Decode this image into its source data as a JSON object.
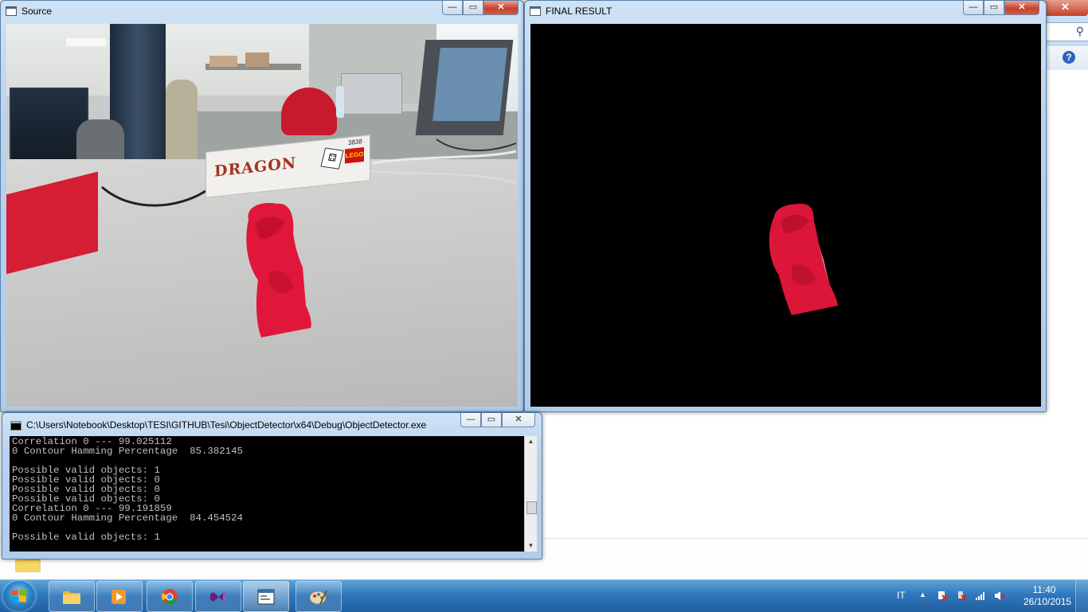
{
  "windows": {
    "source": {
      "title": "Source"
    },
    "final": {
      "title": "FINAL RESULT"
    },
    "console": {
      "title": "C:\\Users\\Notebook\\Desktop\\TESI\\GITHUB\\Tesi\\ObjectDetector\\x64\\Debug\\ObjectDetector.exe",
      "lines": [
        "Correlation 0 --- 99.025112",
        "0 Contour Hamming Percentage  85.382145",
        "",
        "Possible valid objects: 1",
        "Possible valid objects: 0",
        "Possible valid objects: 0",
        "Possible valid objects: 0",
        "Correlation 0 --- 99.191859",
        "0 Contour Hamming Percentage  84.454524",
        "",
        "Possible valid objects: 1"
      ]
    },
    "controls": {
      "minimize": "—",
      "maximize": "▭",
      "close": "✕"
    }
  },
  "scene": {
    "box_text": "DRAGON",
    "box_brand": "LEGO",
    "box_number": "3838"
  },
  "taskbar": {
    "pinned": [
      "file-explorer",
      "media-player",
      "chrome",
      "visual-studio",
      "object-detector",
      "paint"
    ],
    "language": "IT",
    "time": "11:40",
    "date": "26/10/2015"
  }
}
